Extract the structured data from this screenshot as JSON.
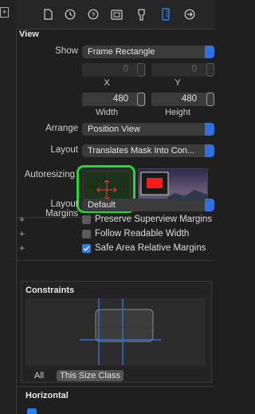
{
  "toolbar": {
    "icons": [
      "file-icon",
      "history-icon",
      "help-icon",
      "identity-icon",
      "attributes-icon",
      "size-ruler-icon",
      "connections-icon"
    ]
  },
  "view_section": {
    "title": "View",
    "show_label": "Show",
    "show_value": "Frame Rectangle",
    "x_value": "0",
    "y_value": "0",
    "x_label": "X",
    "y_label": "Y",
    "width_value": "480",
    "height_value": "480",
    "width_label": "Width",
    "height_label": "Height",
    "arrange_label": "Arrange",
    "arrange_value": "Position View",
    "layout_label": "Layout",
    "layout_value": "Translates Mask Into Con...",
    "autoresizing_label": "Autoresizing"
  },
  "layout_margins": {
    "label": "Layout Margins",
    "value": "Default",
    "options": [
      {
        "label": "Preserve Superview Margins",
        "checked": false
      },
      {
        "label": "Follow Readable Width",
        "checked": false
      },
      {
        "label": "Safe Area Relative Margins",
        "checked": true
      }
    ]
  },
  "constraints": {
    "title": "Constraints",
    "tab_all": "All",
    "tab_size_class": "This Size Class"
  },
  "horizontal": {
    "title": "Horizontal"
  },
  "colors": {
    "accent": "#2f7ef0",
    "highlight_green": "#2ad33a",
    "red": "#ff1a1a"
  }
}
